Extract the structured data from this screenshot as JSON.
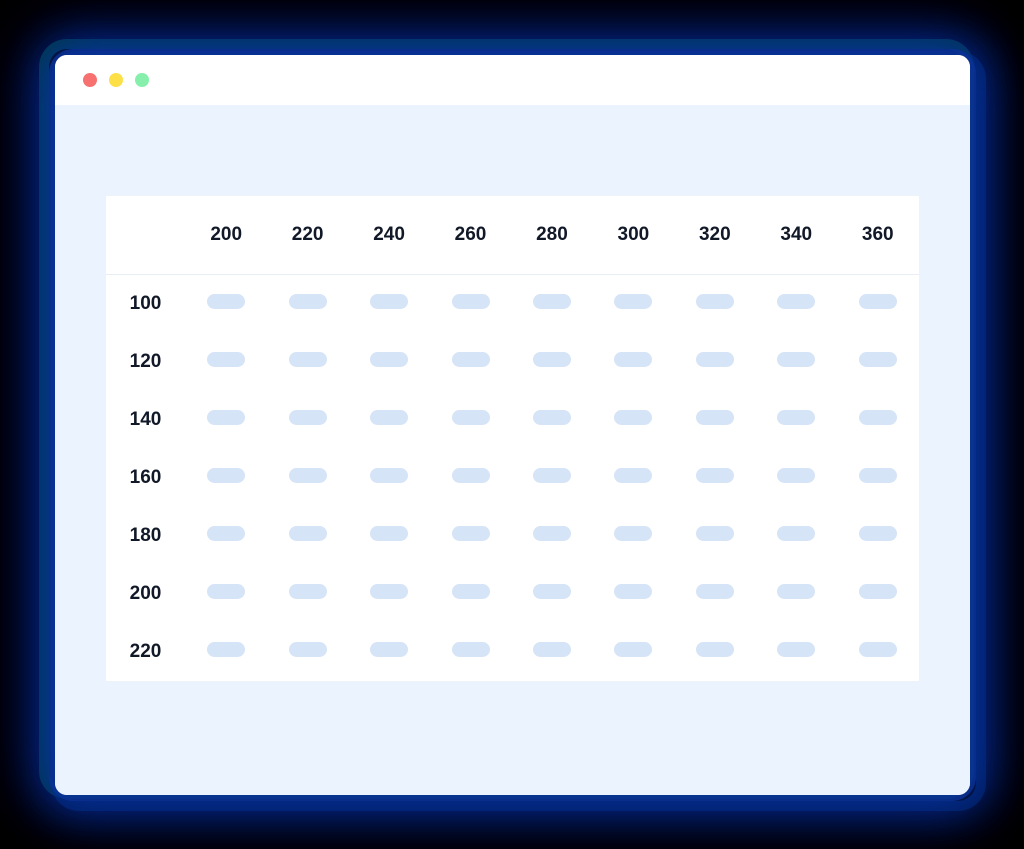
{
  "window": {
    "traffic_lights": [
      "red",
      "yellow",
      "green"
    ]
  },
  "table": {
    "columns": [
      "200",
      "220",
      "240",
      "260",
      "280",
      "300",
      "320",
      "340",
      "360"
    ],
    "rows": [
      "100",
      "120",
      "140",
      "160",
      "180",
      "200",
      "220"
    ],
    "cell_placeholder": "pill"
  }
}
